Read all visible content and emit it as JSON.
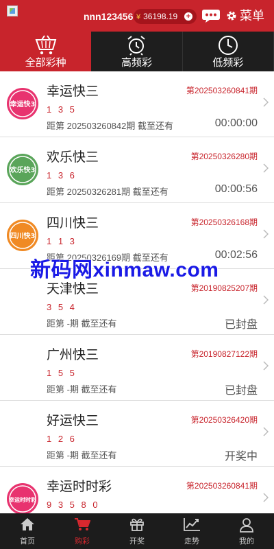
{
  "header": {
    "username": "nnn123456",
    "currency_symbol": "¥",
    "balance": "36198.19",
    "menu_label": "菜单"
  },
  "tabs": [
    {
      "label": "全部彩种",
      "icon": "basket-icon",
      "active": true
    },
    {
      "label": "高频彩",
      "icon": "alarm-clock-icon",
      "active": false
    },
    {
      "label": "低频彩",
      "icon": "clock-icon",
      "active": false
    }
  ],
  "games": [
    {
      "name": "幸运快三",
      "numbers": "1 3 5",
      "issue": "第202503260841期",
      "next": "距第 202503260842期 截至还有",
      "timer": "00:00:00",
      "logo_text": "幸运快3",
      "logo_color": "#e8336f"
    },
    {
      "name": "欢乐快三",
      "numbers": "1 3 6",
      "issue": "第20250326280期",
      "next": "距第 20250326281期 截至还有",
      "timer": "00:00:56",
      "logo_text": "欢乐快3",
      "logo_color": "#5aa55a"
    },
    {
      "name": "四川快三",
      "numbers": "1 1 3",
      "issue": "第20250326168期",
      "next": "距第 20250326169期 截至还有",
      "timer": "00:02:56",
      "logo_text": "四川快3",
      "logo_color": "#f08a24"
    },
    {
      "name": "天津快三",
      "numbers": "3 5 4",
      "issue": "第20190825207期",
      "next": "距第 -期 截至还有",
      "timer": "已封盘"
    },
    {
      "name": "广州快三",
      "numbers": "1 5 5",
      "issue": "第20190827122期",
      "next": "距第 -期 截至还有",
      "timer": "已封盘"
    },
    {
      "name": "好运快三",
      "numbers": "1 2 6",
      "issue": "第20250326420期",
      "next": "距第 -期 截至还有",
      "timer": "开奖中"
    },
    {
      "name": "幸运时时彩",
      "numbers": "9 3 5 8 0",
      "issue": "第202503260841期",
      "next": "",
      "timer": "",
      "logo_text": "幸运时时彩",
      "logo_color": "#e8336f"
    }
  ],
  "watermark": "新码网xinmaw.com",
  "bottom_nav": [
    {
      "label": "首页",
      "icon": "home-icon",
      "active": false
    },
    {
      "label": "购彩",
      "icon": "cart-icon",
      "active": true
    },
    {
      "label": "开奖",
      "icon": "gift-icon",
      "active": false
    },
    {
      "label": "走势",
      "icon": "trend-chart-icon",
      "active": false
    },
    {
      "label": "我的",
      "icon": "user-icon",
      "active": false
    }
  ],
  "colors": {
    "brand_red": "#c8242c",
    "dark_bar": "#1e1e1e",
    "watermark_blue": "#1a1ae6"
  }
}
